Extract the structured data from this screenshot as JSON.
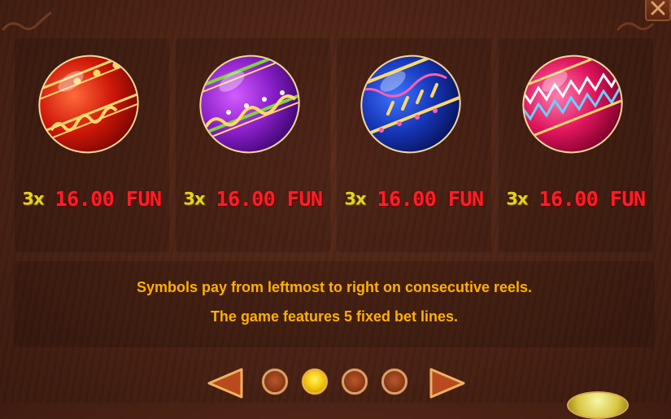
{
  "symbols": [
    {
      "name": "red egg",
      "multiplier": "3x",
      "payout": "16.00 FUN"
    },
    {
      "name": "purple egg",
      "multiplier": "3x",
      "payout": "16.00 FUN"
    },
    {
      "name": "blue egg",
      "multiplier": "3x",
      "payout": "16.00 FUN"
    },
    {
      "name": "pink egg",
      "multiplier": "3x",
      "payout": "16.00 FUN"
    }
  ],
  "info": {
    "line1": "Symbols pay from leftmost to right on consecutive reels.",
    "line2": "The game features 5 fixed bet lines."
  },
  "pagination": {
    "total_pages": 4,
    "current_page": 2
  },
  "icons": {
    "close": "close-icon",
    "prev": "arrow-left-icon",
    "next": "arrow-right-icon"
  },
  "colors": {
    "background": "#4a2214",
    "multiplier": "#e6d21c",
    "payout": "#ff1e28",
    "info_text": "#ffb000",
    "active_dot": "#f3c400"
  }
}
